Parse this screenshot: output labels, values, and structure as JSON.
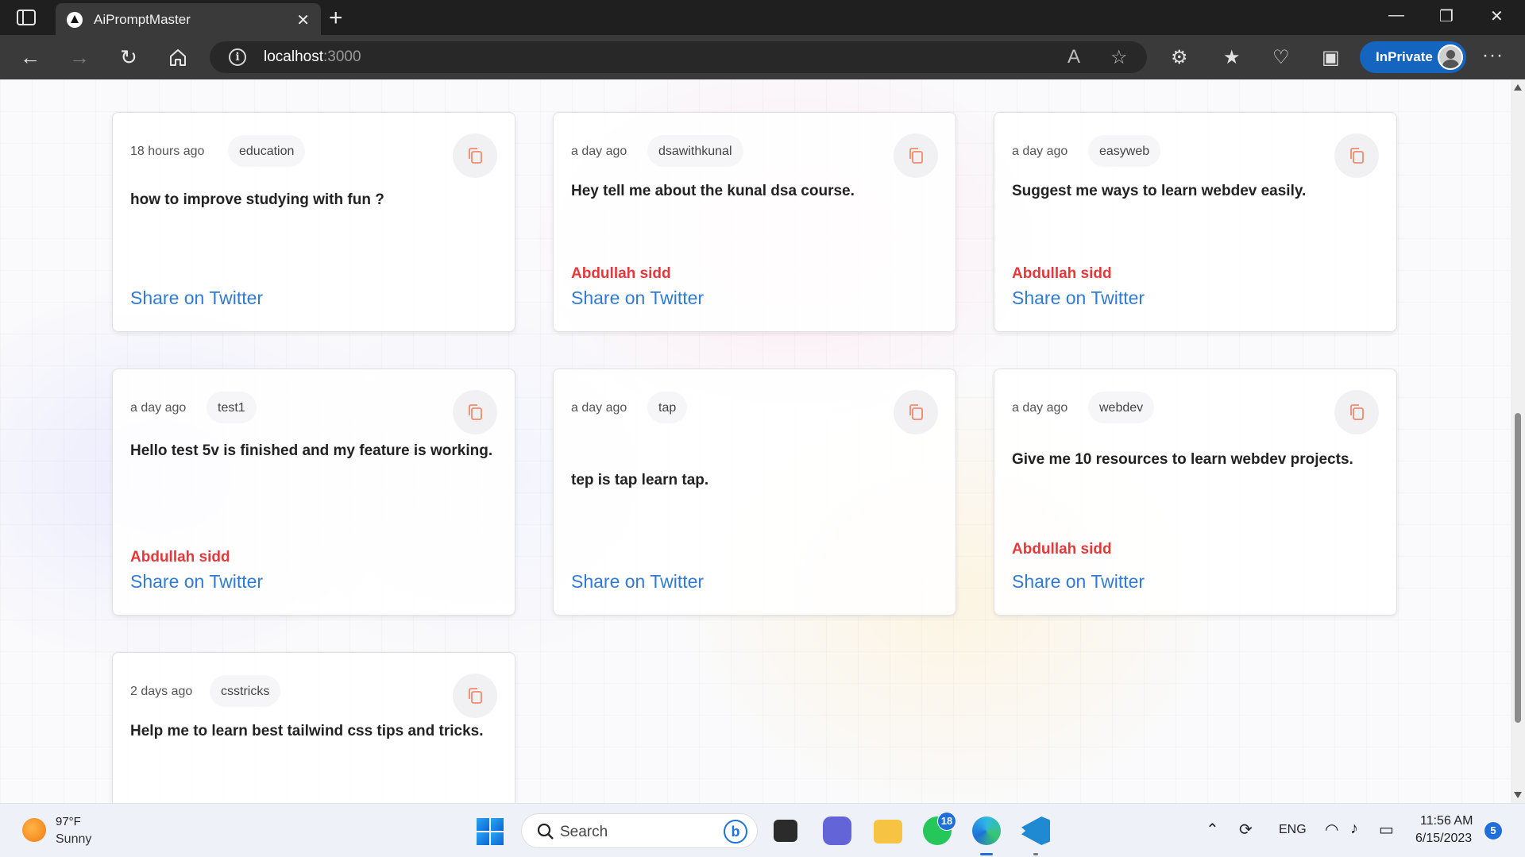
{
  "browser": {
    "tab_title": "AiPromptMaster",
    "url_host": "localhost",
    "url_port": ":3000",
    "inprivate_label": "InPrivate"
  },
  "cards": [
    {
      "time": "18 hours ago",
      "tag": "education",
      "text": "how to improve studying with fun ?",
      "author": "",
      "share": "Share on Twitter"
    },
    {
      "time": "a day ago",
      "tag": "dsawithkunal",
      "text": "Hey tell me about the kunal dsa course.",
      "author": "Abdullah sidd",
      "share": "Share on Twitter"
    },
    {
      "time": "a day ago",
      "tag": "easyweb",
      "text": "Suggest me ways to learn webdev easily.",
      "author": "Abdullah sidd",
      "share": "Share on Twitter"
    },
    {
      "time": "a day ago",
      "tag": "test1",
      "text": "Hello test 5v is finished and my feature is working.",
      "author": "Abdullah sidd",
      "share": "Share on Twitter"
    },
    {
      "time": "a day ago",
      "tag": "tap",
      "text": "tep is tap learn tap.",
      "author": "",
      "share": "Share on Twitter"
    },
    {
      "time": "a day ago",
      "tag": "webdev",
      "text": "Give me 10 resources to learn webdev projects.",
      "author": "Abdullah sidd",
      "share": "Share on Twitter"
    },
    {
      "time": "2 days ago",
      "tag": "csstricks",
      "text": "Help me to learn best tailwind css tips and tricks.",
      "author": "",
      "share": ""
    }
  ],
  "taskbar": {
    "temp": "97°F",
    "condition": "Sunny",
    "search_label": "Search",
    "whatsapp_badge": "18",
    "lang": "ENG",
    "time": "11:56 AM",
    "date": "6/15/2023",
    "notif_count": "5"
  },
  "colors": {
    "author": "#e5383b",
    "share": "#2f7bd6",
    "copy_icon": "#f08a6c",
    "inprivate": "#1565c0"
  }
}
